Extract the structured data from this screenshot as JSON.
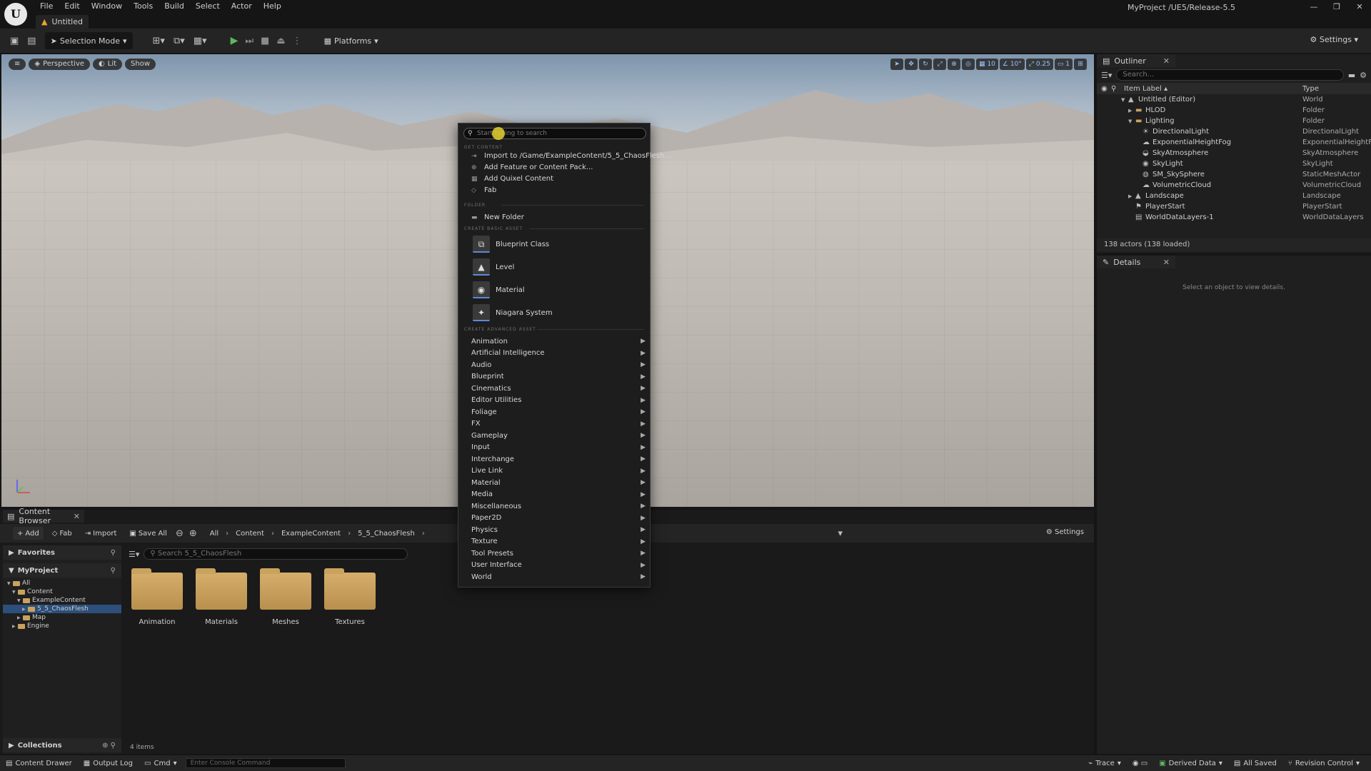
{
  "app": {
    "logo": "U",
    "menu": [
      "File",
      "Edit",
      "Window",
      "Tools",
      "Build",
      "Select",
      "Actor",
      "Help"
    ],
    "doc_tab": "Untitled",
    "project": "MyProject /UE5/Release-5.5"
  },
  "toolbar": {
    "selection_mode": "Selection Mode",
    "platforms": "Platforms",
    "settings": "Settings"
  },
  "viewport": {
    "perspective": "Perspective",
    "lit": "Lit",
    "show": "Show",
    "grid_snap": "10",
    "rot_snap": "10°",
    "scale_snap": "0.25",
    "cam_speed": "1"
  },
  "outliner": {
    "tab": "Outliner",
    "search_placeholder": "Search...",
    "col_label": "Item Label",
    "col_type": "Type",
    "rows": [
      {
        "label": "Untitled (Editor)",
        "type": "World",
        "indent": 0,
        "arrow": "▼",
        "icon": "▲"
      },
      {
        "label": "HLOD",
        "type": "Folder",
        "indent": 1,
        "arrow": "▶",
        "icon": "▬"
      },
      {
        "label": "Lighting",
        "type": "Folder",
        "indent": 1,
        "arrow": "▼",
        "icon": "▬"
      },
      {
        "label": "DirectionalLight",
        "type": "DirectionalLight",
        "indent": 2,
        "arrow": "",
        "icon": "☀"
      },
      {
        "label": "ExponentialHeightFog",
        "type": "ExponentialHeightFog",
        "indent": 2,
        "arrow": "",
        "icon": "☁"
      },
      {
        "label": "SkyAtmosphere",
        "type": "SkyAtmosphere",
        "indent": 2,
        "arrow": "",
        "icon": "◒"
      },
      {
        "label": "SkyLight",
        "type": "SkyLight",
        "indent": 2,
        "arrow": "",
        "icon": "◉"
      },
      {
        "label": "SM_SkySphere",
        "type": "StaticMeshActor",
        "indent": 2,
        "arrow": "",
        "icon": "◍"
      },
      {
        "label": "VolumetricCloud",
        "type": "VolumetricCloud",
        "indent": 2,
        "arrow": "",
        "icon": "☁"
      },
      {
        "label": "Landscape",
        "type": "Landscape",
        "indent": 1,
        "arrow": "▶",
        "icon": "▲"
      },
      {
        "label": "PlayerStart",
        "type": "PlayerStart",
        "indent": 1,
        "arrow": "",
        "icon": "⚑"
      },
      {
        "label": "WorldDataLayers-1",
        "type": "WorldDataLayers",
        "indent": 1,
        "arrow": "",
        "icon": "▤"
      }
    ],
    "status": "138 actors (138 loaded)"
  },
  "details": {
    "tab": "Details",
    "empty": "Select an object to view details."
  },
  "content_browser": {
    "tab": "Content Browser",
    "add": "Add",
    "fab": "Fab",
    "import": "Import",
    "save_all": "Save All",
    "crumbs": [
      "All",
      "Content",
      "ExampleContent",
      "5_5_ChaosFlesh"
    ],
    "settings": "Settings",
    "favorites": "Favorites",
    "project": "MyProject",
    "tree": [
      {
        "label": "All",
        "indent": 0,
        "arrow": "▼",
        "sel": false
      },
      {
        "label": "Content",
        "indent": 1,
        "arrow": "▼",
        "sel": false
      },
      {
        "label": "ExampleContent",
        "indent": 2,
        "arrow": "▼",
        "sel": false
      },
      {
        "label": "5_5_ChaosFlesh",
        "indent": 3,
        "arrow": "▶",
        "sel": true
      },
      {
        "label": "Map",
        "indent": 2,
        "arrow": "▶",
        "sel": false
      },
      {
        "label": "Engine",
        "indent": 1,
        "arrow": "▶",
        "sel": false
      }
    ],
    "collections": "Collections",
    "search_placeholder": "Search 5_5_ChaosFlesh",
    "folders": [
      "Animation",
      "Materials",
      "Meshes",
      "Textures"
    ],
    "items_count": "4 items"
  },
  "statusbar": {
    "content_drawer": "Content Drawer",
    "output_log": "Output Log",
    "cmd": "Cmd",
    "console_placeholder": "Enter Console Command",
    "trace": "Trace",
    "derived_data": "Derived Data",
    "all_saved": "All Saved",
    "revision_control": "Revision Control"
  },
  "context_menu": {
    "search_placeholder": "Start typing to search",
    "sec_get_content": "GET CONTENT",
    "get_content": [
      {
        "label": "Import to /Game/ExampleContent/5_5_ChaosFlesh...",
        "icon": "⇥"
      },
      {
        "label": "Add Feature or Content Pack...",
        "icon": "⊕"
      },
      {
        "label": "Add Quixel Content",
        "icon": "▦"
      },
      {
        "label": "Fab",
        "icon": "◇"
      }
    ],
    "sec_folder": "FOLDER",
    "new_folder": "New Folder",
    "sec_basic": "CREATE BASIC ASSET",
    "basic": [
      {
        "label": "Blueprint Class",
        "icon": "⧉"
      },
      {
        "label": "Level",
        "icon": "▲"
      },
      {
        "label": "Material",
        "icon": "◉"
      },
      {
        "label": "Niagara System",
        "icon": "✦"
      }
    ],
    "sec_advanced": "CREATE ADVANCED ASSET",
    "advanced": [
      "Animation",
      "Artificial Intelligence",
      "Audio",
      "Blueprint",
      "Cinematics",
      "Editor Utilities",
      "Foliage",
      "FX",
      "Gameplay",
      "Input",
      "Interchange",
      "Live Link",
      "Material",
      "Media",
      "Miscellaneous",
      "Paper2D",
      "Physics",
      "Texture",
      "Tool Presets",
      "User Interface",
      "World"
    ]
  }
}
